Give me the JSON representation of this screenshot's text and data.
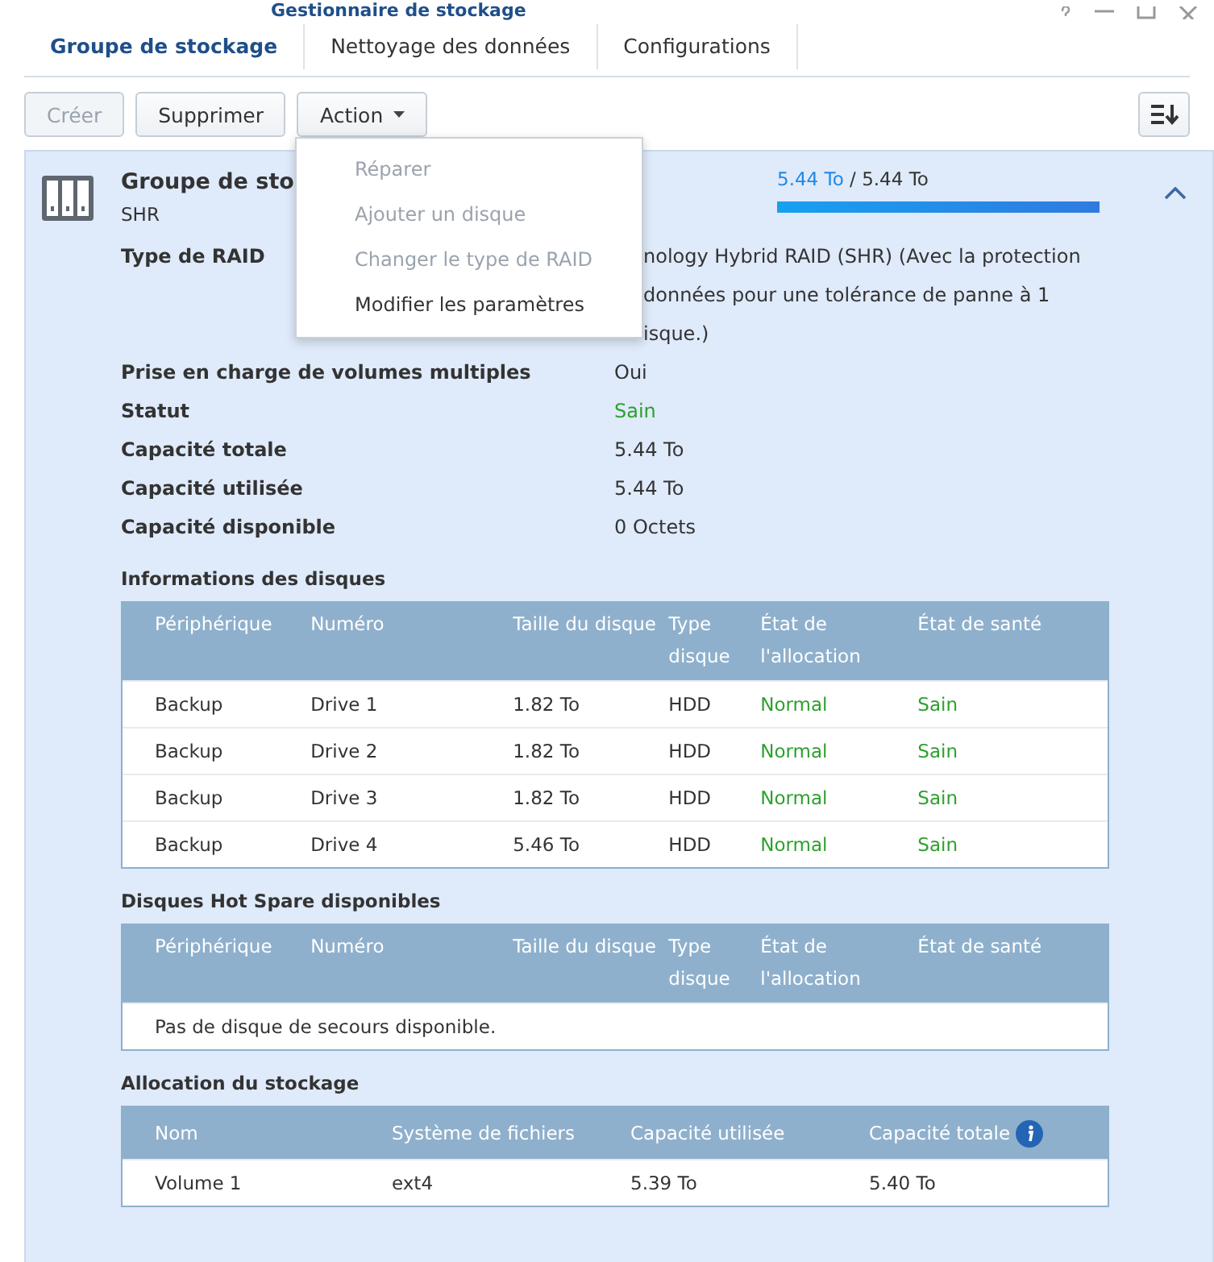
{
  "window": {
    "title": "Gestionnaire de stockage"
  },
  "tabs": [
    {
      "label": "Groupe de stockage",
      "selected": true
    },
    {
      "label": "Nettoyage des données",
      "selected": false
    },
    {
      "label": "Configurations",
      "selected": false
    }
  ],
  "toolbar": {
    "buttons": [
      {
        "label": "Créer",
        "disabled": true,
        "kind": "button"
      },
      {
        "label": "Supprimer",
        "disabled": false,
        "kind": "button"
      },
      {
        "label": "Action",
        "disabled": false,
        "kind": "dropdown"
      }
    ]
  },
  "action_menu": {
    "items": [
      {
        "label": "Réparer",
        "disabled": true
      },
      {
        "label": "Ajouter un disque",
        "disabled": true
      },
      {
        "label": "Changer le type de RAID",
        "disabled": true
      },
      {
        "label": "Modifier les paramètres",
        "disabled": false
      }
    ]
  },
  "pool": {
    "title": "Groupe de sto",
    "subtitle": "SHR",
    "used": "5.44 To",
    "separator": "/",
    "total": "5.44 To",
    "level": 1,
    "expanded": true,
    "properties": [
      {
        "label": "Type de RAID",
        "lines": [
          "nology Hybrid RAID (SHR) (Avec la protection",
          "données pour une tolérance de panne à 1",
          "isque.)"
        ],
        "kind": "text"
      },
      {
        "label": "Prise en charge de volumes multiples",
        "lines": [
          "Oui"
        ],
        "kind": "text"
      },
      {
        "label": "Statut",
        "lines": [
          "Sain"
        ],
        "kind": "status"
      },
      {
        "label": "Capacité totale",
        "lines": [
          "5.44 To"
        ],
        "kind": "text"
      },
      {
        "label": "Capacité utilisée",
        "lines": [
          "5.44 To"
        ],
        "kind": "text"
      },
      {
        "label": "Capacité disponible",
        "lines": [
          "0 Octets"
        ],
        "kind": "text"
      }
    ]
  },
  "disks": {
    "title": "Informations des disques",
    "columns": [
      {
        "label": "Périphérique",
        "kind": "text"
      },
      {
        "label": "Numéro",
        "kind": "text"
      },
      {
        "label": "Taille du disque",
        "kind": "text"
      },
      {
        "label": "Type disque",
        "kind": "text"
      },
      {
        "label": "État de l'allocation",
        "kind": "status"
      },
      {
        "label": "État de santé",
        "kind": "status"
      }
    ],
    "rows": [
      [
        "Backup",
        "Drive 1",
        "1.82 To",
        "HDD",
        "Normal",
        "Sain"
      ],
      [
        "Backup",
        "Drive 2",
        "1.82 To",
        "HDD",
        "Normal",
        "Sain"
      ],
      [
        "Backup",
        "Drive 3",
        "1.82 To",
        "HDD",
        "Normal",
        "Sain"
      ],
      [
        "Backup",
        "Drive 4",
        "5.46 To",
        "HDD",
        "Normal",
        "Sain"
      ]
    ]
  },
  "hot_spare": {
    "title": "Disques Hot Spare disponibles",
    "columns": [
      {
        "label": "Périphérique"
      },
      {
        "label": "Numéro"
      },
      {
        "label": "Taille du disque"
      },
      {
        "label": "Type disque"
      },
      {
        "label": "État de l'allocation"
      },
      {
        "label": "État de santé"
      }
    ],
    "empty": "Pas de disque de secours disponible."
  },
  "allocation": {
    "title": "Allocation du stockage",
    "columns": [
      {
        "label": "Nom",
        "info": false
      },
      {
        "label": "Système de fichiers",
        "info": false
      },
      {
        "label": "Capacité utilisée",
        "info": false
      },
      {
        "label": "Capacité totale",
        "info": true
      }
    ],
    "rows": [
      [
        "Volume 1",
        "ext4",
        "5.39 To",
        "5.40 To"
      ]
    ]
  }
}
